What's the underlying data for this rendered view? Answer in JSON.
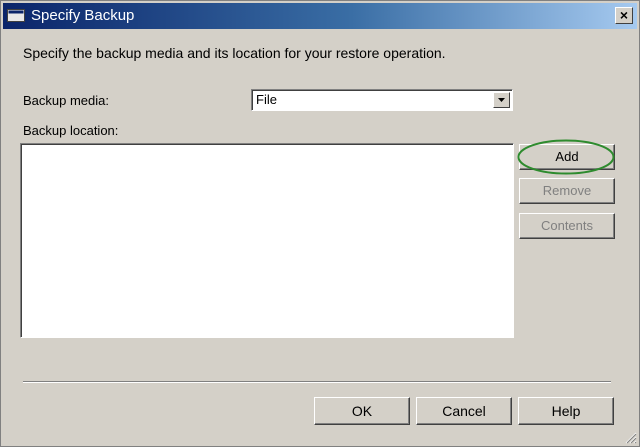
{
  "window": {
    "title": "Specify Backup",
    "close_label": "×"
  },
  "instruction": "Specify the backup media and its location for your restore operation.",
  "backup_media": {
    "label": "Backup media:",
    "selected": "File"
  },
  "backup_location": {
    "label": "Backup location:",
    "items": []
  },
  "side_buttons": {
    "add": "Add",
    "remove": "Remove",
    "contents": "Contents"
  },
  "footer_buttons": {
    "ok": "OK",
    "cancel": "Cancel",
    "help": "Help"
  },
  "colors": {
    "title_gradient_start": "#0a246a",
    "title_gradient_end": "#a6caf0",
    "highlight_ellipse": "#2e8b2e"
  }
}
